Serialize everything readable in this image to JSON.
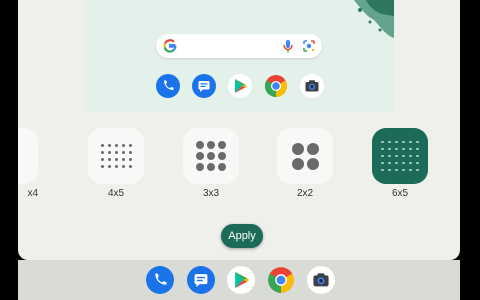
{
  "preview": {
    "search": {
      "icons": [
        "google-g-icon",
        "mic-icon",
        "lens-icon"
      ]
    },
    "dock_apps": [
      "phone-icon",
      "messages-icon",
      "play-store-icon",
      "chrome-icon",
      "camera-icon"
    ]
  },
  "grid_options": [
    {
      "label": "x4",
      "cols": 2,
      "rows": 4,
      "selected": false
    },
    {
      "label": "4x5",
      "cols": 5,
      "rows": 4,
      "selected": false
    },
    {
      "label": "3x3",
      "cols": 3,
      "rows": 3,
      "selected": false
    },
    {
      "label": "2x2",
      "cols": 2,
      "rows": 2,
      "selected": false
    },
    {
      "label": "6x5",
      "cols": 6,
      "rows": 5,
      "selected": true
    }
  ],
  "apply": {
    "label": "Apply"
  },
  "dock": {
    "apps": [
      "phone-icon",
      "messages-icon",
      "play-store-icon",
      "chrome-icon",
      "camera-icon"
    ]
  },
  "colors": {
    "accent": "#1c6a58",
    "sheet": "#eef0ec",
    "tile": "#f8f9f6"
  }
}
